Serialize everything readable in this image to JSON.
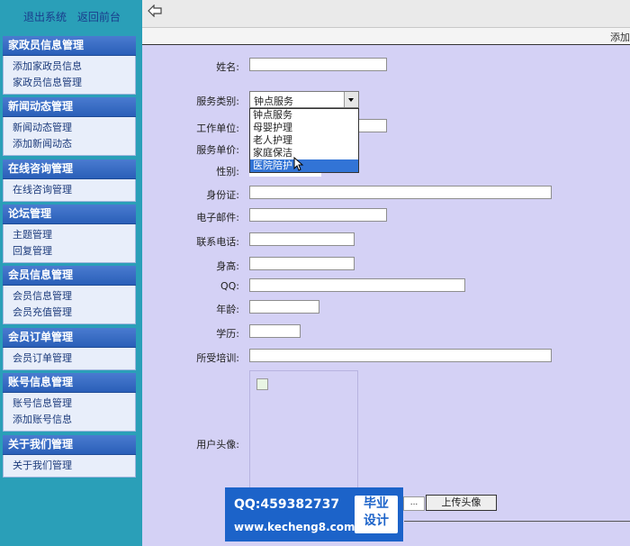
{
  "top_links": {
    "logout": "退出系统",
    "home": "返回前台"
  },
  "breadcrumb": "添加",
  "sidebar": [
    {
      "title": "家政员信息管理",
      "items": [
        "添加家政员信息",
        "家政员信息管理"
      ]
    },
    {
      "title": "新闻动态管理",
      "items": [
        "新闻动态管理",
        "添加新闻动态"
      ]
    },
    {
      "title": "在线咨询管理",
      "items": [
        "在线咨询管理"
      ]
    },
    {
      "title": "论坛管理",
      "items": [
        "主题管理",
        "回复管理"
      ]
    },
    {
      "title": "会员信息管理",
      "items": [
        "会员信息管理",
        "会员充值管理"
      ]
    },
    {
      "title": "会员订单管理",
      "items": [
        "会员订单管理"
      ]
    },
    {
      "title": "账号信息管理",
      "items": [
        "账号信息管理",
        "添加账号信息"
      ]
    },
    {
      "title": "关于我们管理",
      "items": [
        "关于我们管理"
      ]
    }
  ],
  "form": {
    "name_label": "姓名:",
    "service_type_label": "服务类别:",
    "service_type_value": "钟点服务",
    "service_options": [
      "钟点服务",
      "母婴护理",
      "老人护理",
      "家庭保洁",
      "医院陪护"
    ],
    "work_unit_label": "工作单位:",
    "price_label": "服务单价:",
    "gender_label": "性别:",
    "id_label": "身份证:",
    "email_label": "电子邮件:",
    "phone_label": "联系电话:",
    "height_label": "身高:",
    "qq_label": "QQ:",
    "age_label": "年龄:",
    "edu_label": "学历:",
    "training_label": "所受培训:",
    "avatar_label": "用户头像:",
    "upload_button": "上传头像",
    "file_button": "..."
  },
  "watermark": {
    "qq": "QQ:459382737",
    "site": "www.kecheng8.com",
    "logo_line1": "毕业",
    "logo_line2": "设计"
  }
}
